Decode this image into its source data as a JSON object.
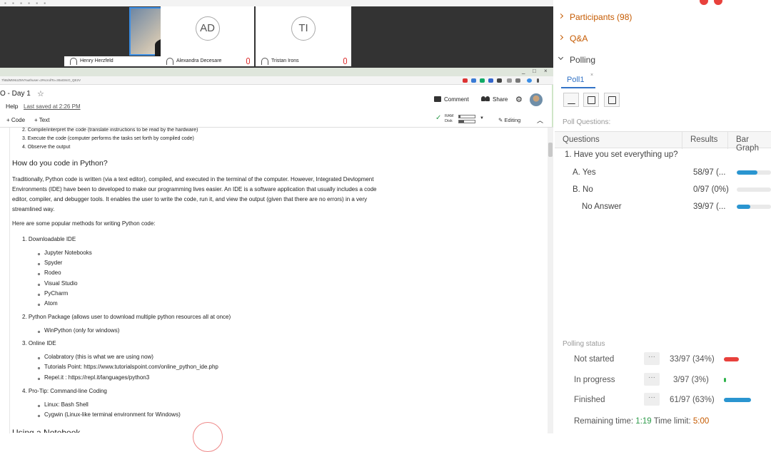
{
  "video": {
    "tiles": [
      {
        "name": "Henry Herzfeld",
        "initials": ""
      },
      {
        "name": "Alexandra Decesare",
        "initials": "AD"
      },
      {
        "name": "Tristan Irons",
        "initials": "TI"
      }
    ]
  },
  "browser": {
    "url": "7hBdM5NUZ5N?authuser=2#scrollTo=30aG8cO_QE2V",
    "window_controls": [
      "_",
      "□",
      "×"
    ]
  },
  "notebook": {
    "title": "O - Day 1",
    "menu_help": "Help",
    "last_saved": "Last saved at 2:26 PM",
    "comment_label": "Comment",
    "share_label": "Share",
    "add_code_label": "+ Code",
    "add_text_label": "+ Text",
    "ram_label": "RAM",
    "disk_label": "Disk",
    "ram_usage": 0.1,
    "disk_usage": 0.3,
    "editing_label": "Editing"
  },
  "content": {
    "steps_tail": [
      "2. Compile/interpret the code (translate instructions to be read by the hardware)",
      "3. Execute the code (computer performs the tasks set forth by compiled code)",
      "4. Observe the output"
    ],
    "heading": "How do you code in Python?",
    "para_lines": [
      "Traditionally, Python code is written (via a text editor), compiled, and executed in the terminal of the computer. However, Integrated Devlopment",
      "Environments (IDE) have been to developed to make our programming lives easier. An IDE is a software application that usually includes a code",
      "editor, compiler, and debugger tools. It enables the user to write the code, run it, and view the output (given that there are no errors) in a very",
      "streamlined way."
    ],
    "intro": "Here are some popular methods for writing Python code:",
    "s1": "1. Downloadable IDE",
    "s1_items": [
      "Jupyter Notebooks",
      "Spyder",
      "Rodeo",
      "Visual Studio",
      "PyCharm",
      "Atom"
    ],
    "s2": "2. Python Package (allows user to download multiple python resources all at once)",
    "s2_items": [
      "WinPython (only for windows)"
    ],
    "s3": "3. Online IDE",
    "s3_item1": "Colabratory (this is what we are using now)",
    "s3_item2_prefix": "Tutorials Point: ",
    "s3_item2_link": "https://www.tutorialspoint.com/online_python_ide.php",
    "s3_item3_prefix": "Repel.it : ",
    "s3_item3_link": "https://repl.it/languages/python3",
    "s4": "4. Pro-Tip: Command-line Coding",
    "s4_items": [
      "Linux: Bash Shell",
      "Cygwin (Linux-like terminal environment for Windows)"
    ],
    "next_heading": "Using a Notebook"
  },
  "panel": {
    "participants": "Participants (98)",
    "qa": "Q&A",
    "polling": "Polling",
    "poll_tab": "Poll1",
    "poll_tab_close": "×",
    "poll_questions_label": "Poll Questions:",
    "columns": [
      "Questions",
      "Results",
      "Bar Graph"
    ],
    "question": "1.  Have you set everything up?",
    "answers": [
      {
        "option": "A.  Yes",
        "result": "58/97 (...",
        "fraction": 0.598
      },
      {
        "option": "B.  No",
        "result": "0/97 (0%)",
        "fraction": 0.0
      },
      {
        "option": "No Answer",
        "result": "39/97 (...",
        "fraction": 0.402
      }
    ],
    "polling_status_label": "Polling status",
    "status": [
      {
        "label": "Not started",
        "value": "33/97 (34%)",
        "fraction": 0.34,
        "color": "#e8413c"
      },
      {
        "label": "In progress",
        "value": "3/97 (3%)",
        "fraction": 0.03,
        "color": "#2eb34a"
      },
      {
        "label": "Finished",
        "value": "61/97 (63%)",
        "fraction": 0.63,
        "color": "#2a95d0"
      }
    ],
    "dots": "···",
    "remaining_label": "Remaining time:",
    "remaining_value": "1:19",
    "limit_label": "Time limit:",
    "limit_value": "5:00"
  },
  "colors": {
    "accent_orange": "#c55a00",
    "accent_blue": "#3373c6",
    "bar_blue": "#2a95d0"
  }
}
